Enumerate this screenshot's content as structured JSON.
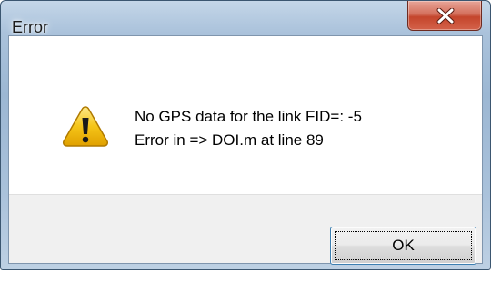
{
  "window": {
    "title": "Error"
  },
  "titlebar": {
    "close_icon": "close-x-icon"
  },
  "dialog": {
    "icon": "warning-icon",
    "message_line1": "No GPS data for the link FID=: -5",
    "message_line2": "Error in => DOI.m at line 89",
    "ok_label": "OK"
  },
  "colors": {
    "close_button": "#c4452c",
    "warning_fill": "#f5c518",
    "focus_border": "#3c7fb1"
  }
}
